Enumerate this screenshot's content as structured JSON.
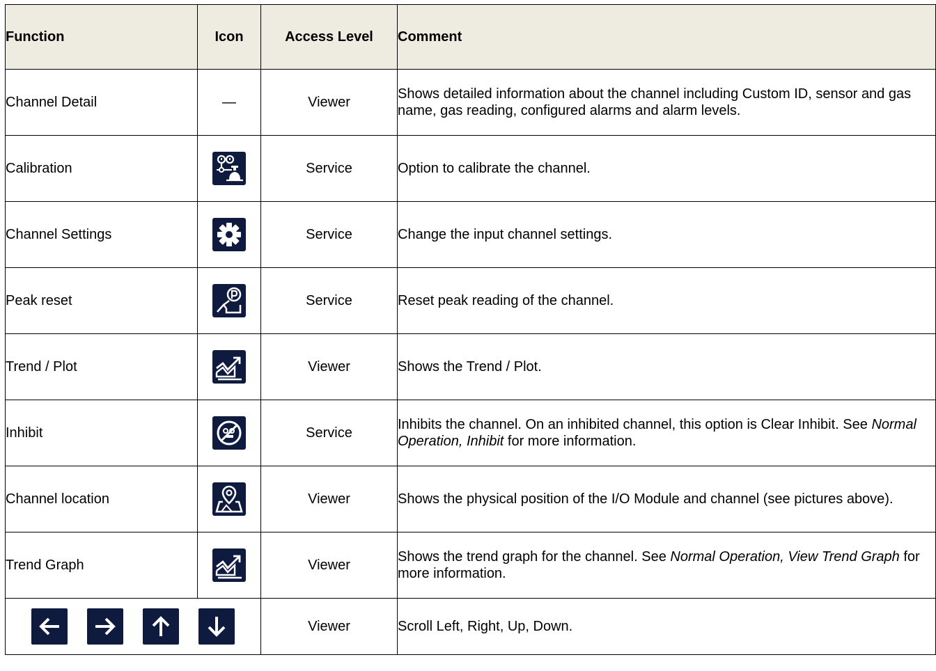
{
  "header": {
    "function": "Function",
    "icon": "Icon",
    "access": "Access Level",
    "comment": "Comment"
  },
  "rows": [
    {
      "function": "Channel Detail",
      "icon": "em-dash",
      "icon_text": "—",
      "access": "Viewer",
      "comment": {
        "p1": "Shows detailed information about the channel including Custom ID, sensor and gas name, gas reading, configured alarms and alarm levels.",
        "i1": "",
        "p2": "",
        "i2": "",
        "p3": ""
      }
    },
    {
      "function": "Calibration",
      "icon": "calibration-icon",
      "access": "Service",
      "comment": {
        "p1": "Option to calibrate the channel.",
        "i1": "",
        "p2": "",
        "i2": "",
        "p3": ""
      }
    },
    {
      "function": "Channel Settings",
      "icon": "gear-icon",
      "access": "Service",
      "comment": {
        "p1": "Change the input channel settings.",
        "i1": "",
        "p2": "",
        "i2": "",
        "p3": ""
      }
    },
    {
      "function": "Peak reset",
      "icon": "peak-reset-icon",
      "access": "Service",
      "comment": {
        "p1": "Reset peak reading of the channel.",
        "i1": "",
        "p2": "",
        "i2": "",
        "p3": ""
      }
    },
    {
      "function": "Trend / Plot",
      "icon": "trend-icon",
      "access": "Viewer",
      "comment": {
        "p1": "Shows the Trend / Plot.",
        "i1": "",
        "p2": "",
        "i2": "",
        "p3": ""
      }
    },
    {
      "function": "Inhibit",
      "icon": "inhibit-icon",
      "access": "Service",
      "comment": {
        "p1": "Inhibits the channel. On an inhibited channel, this option is Clear Inhibit. See ",
        "i1": "Normal Operation, Inhibit",
        "p2": " for more information.",
        "i2": "",
        "p3": ""
      }
    },
    {
      "function": "Channel location",
      "icon": "location-icon",
      "access": "Viewer",
      "comment": {
        "p1": "Shows the physical position of the I/O Module and channel (see pictures above).",
        "i1": "",
        "p2": "",
        "i2": "",
        "p3": ""
      }
    },
    {
      "function": "Trend Graph",
      "icon": "trend-icon",
      "access": "Viewer",
      "comment": {
        "p1": "Shows the trend graph for the channel. See ",
        "i1": "Normal Operation, View Trend Graph",
        "p2": " for more information.",
        "i2": "",
        "p3": ""
      }
    }
  ],
  "scroll_row": {
    "icons": [
      "arrow-left-icon",
      "arrow-right-icon",
      "arrow-up-icon",
      "arrow-down-icon"
    ],
    "access": "Viewer",
    "comment": "Scroll Left, Right, Up, Down."
  },
  "colors": {
    "header_bg": "#EEECE1",
    "icon_bg": "#0E1A3E",
    "icon_fg": "#FFFFFF"
  }
}
